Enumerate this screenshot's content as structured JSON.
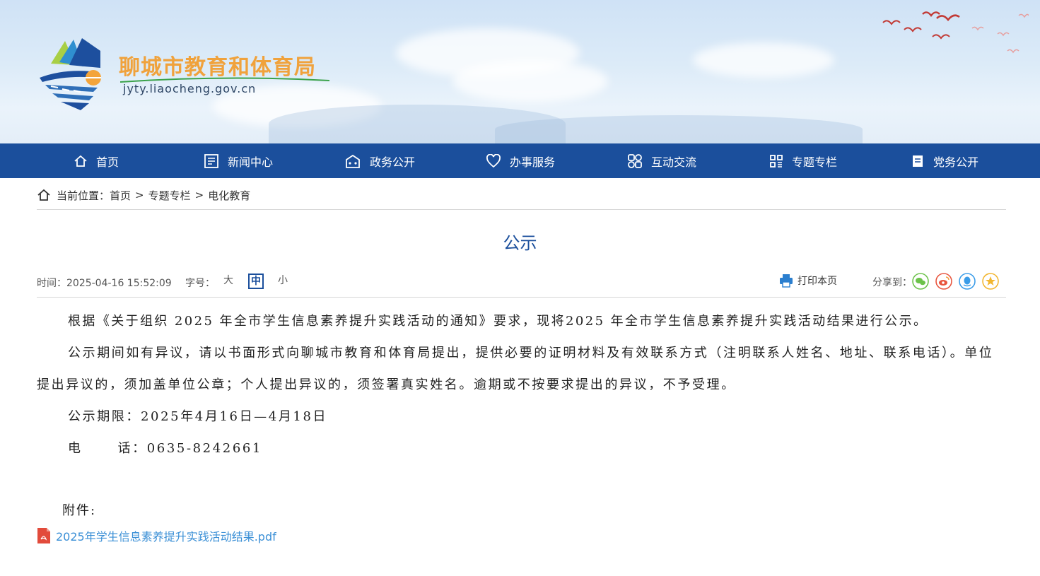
{
  "header": {
    "site_title": "聊城市教育和体育局",
    "site_domain": "jyty.liaocheng.gov.cn"
  },
  "nav": {
    "items": [
      {
        "label": "首页",
        "icon": "home-icon"
      },
      {
        "label": "新闻中心",
        "icon": "news-icon"
      },
      {
        "label": "政务公开",
        "icon": "government-icon"
      },
      {
        "label": "办事服务",
        "icon": "heart-icon"
      },
      {
        "label": "互动交流",
        "icon": "interaction-icon"
      },
      {
        "label": "专题专栏",
        "icon": "grid-icon"
      },
      {
        "label": "党务公开",
        "icon": "document-icon"
      }
    ],
    "background": "#1b4f9c"
  },
  "breadcrumb": {
    "label": "当前位置：",
    "items": [
      "首页",
      "专题专栏",
      "电化教育"
    ],
    "separator": ">"
  },
  "article": {
    "title": "公示",
    "time_label": "时间：",
    "time": "2025-04-16 15:52:09",
    "font_size_label": "字号：",
    "font_sizes": [
      "大",
      "中",
      "小"
    ],
    "font_size_selected": "中",
    "print_label": "打印本页",
    "share_label": "分享到：",
    "share_targets": [
      "wechat-icon",
      "weibo-icon",
      "qq-icon",
      "qzone-icon"
    ],
    "paragraphs": [
      "根据《关于组织 2025 年全市学生信息素养提升实践活动的通知》要求，现将2025 年全市学生信息素养提升实践活动结果进行公示。",
      "公示期间如有异议，请以书面形式向聊城市教育和体育局提出，提供必要的证明材料及有效联系方式（注明联系人姓名、地址、联系电话）。单位提出异议的，须加盖单位公章；个人提出异议的，须签署真实姓名。逾期或不按要求提出的异议，不予受理。",
      "公示期限：2025年4月16日—4月18日",
      "电      话：0635-8242661"
    ],
    "attachment_label": "附件:",
    "attachment_name": "2025年学生信息素养提升实践活动结果.pdf"
  },
  "colors": {
    "brand_blue": "#1b4f9c",
    "title_orange": "#f0a23c",
    "link_blue": "#3a8fd6"
  }
}
